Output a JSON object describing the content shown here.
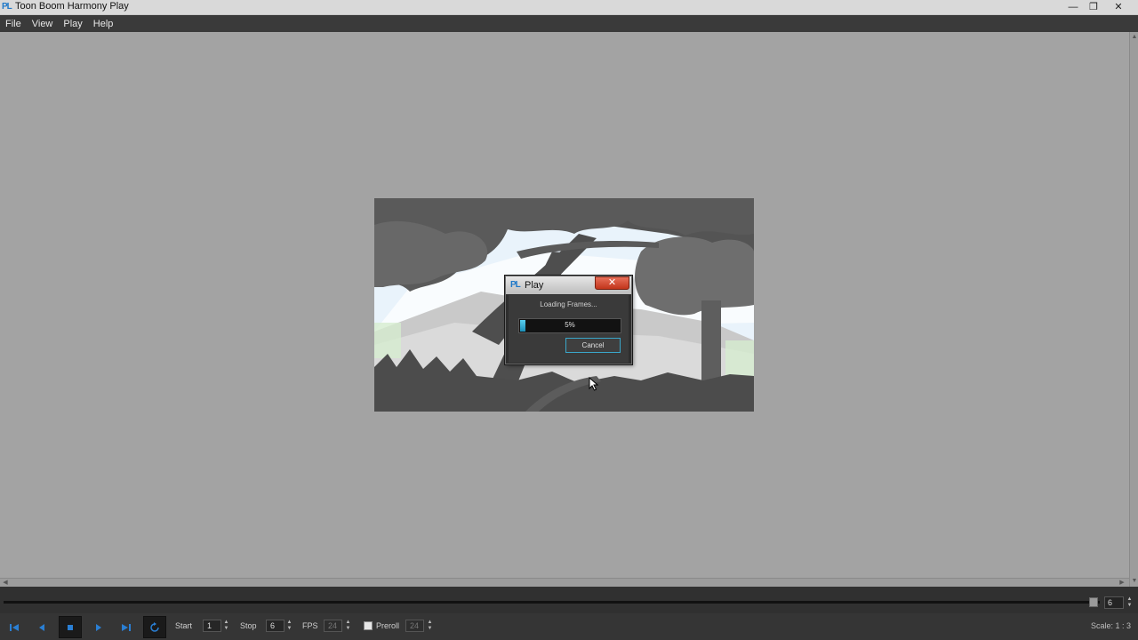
{
  "window": {
    "title": "Toon Boom Harmony Play",
    "logo": "PL",
    "minimize_icon": "minimize-icon",
    "maximize_icon": "maximize-icon",
    "close_icon": "close-icon"
  },
  "menu": {
    "items": [
      "File",
      "View",
      "Play",
      "Help"
    ]
  },
  "dialog": {
    "logo": "PL",
    "title": "Play",
    "message": "Loading Frames...",
    "progress_percent": 5,
    "progress_text": "5%",
    "cancel_label": "Cancel",
    "accent_color": "#3aa6c9",
    "close_color": "#c2351b"
  },
  "timeline": {
    "current_frame": "6"
  },
  "transport": {
    "start_label": "Start",
    "start_value": "1",
    "stop_label": "Stop",
    "stop_value": "6",
    "fps_label": "FPS",
    "fps_value": "24",
    "preroll_label": "Preroll",
    "preroll_value": "24",
    "scale_text": "Scale:  1 : 3",
    "button_color": "#2a7fd4"
  }
}
